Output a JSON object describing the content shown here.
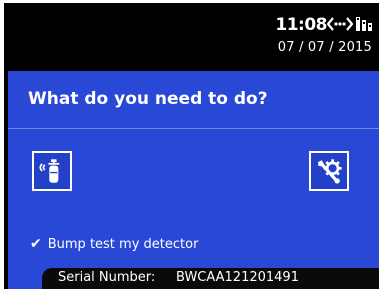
{
  "status": {
    "time": "11:08",
    "date": "07 / 07 / 2015",
    "comm_icon": "wireless-comm-icon",
    "battery_icon": "battery-icon"
  },
  "main": {
    "question": "What do you need to do?",
    "options": [
      {
        "icon": "bump-test-gas-icon"
      },
      {
        "icon": "wrench-gear-settings-icon"
      }
    ],
    "selected_label": "Bump test my detector",
    "selected_check": "✔"
  },
  "footer": {
    "serial_label": "Serial Number:",
    "serial_value": "BWCAA121201491"
  },
  "colors": {
    "panel": "#2a48d6",
    "background": "#000000",
    "text": "#ffffff"
  }
}
